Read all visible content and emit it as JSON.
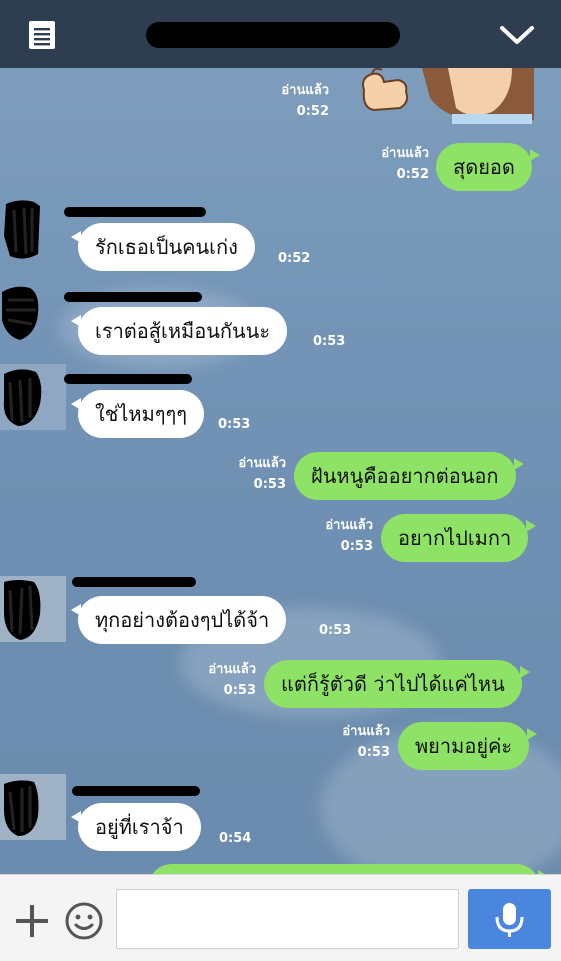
{
  "header": {
    "title": "",
    "menu_icon": "list-icon",
    "collapse_icon": "chevron-down-icon"
  },
  "messages": [
    {
      "side": "out",
      "kind": "sticker",
      "read": "อ่านแล้ว",
      "time": "0:52"
    },
    {
      "side": "out",
      "text": "สุดยอด",
      "read": "อ่านแล้ว",
      "time": "0:52"
    },
    {
      "side": "in",
      "text": "รักเธอเป็นคนเก่ง",
      "time": "0:52"
    },
    {
      "side": "in",
      "text": "เราต่อสู้เหมือนกันนะ",
      "time": "0:53"
    },
    {
      "side": "in",
      "text": "ใช่ไหมๆๆๆ",
      "time": "0:53"
    },
    {
      "side": "out",
      "text": "ฝันหนูคืออยากต่อนอก",
      "read": "อ่านแล้ว",
      "time": "0:53"
    },
    {
      "side": "out",
      "text": "อยากไปเมกา",
      "read": "อ่านแล้ว",
      "time": "0:53"
    },
    {
      "side": "in",
      "text": "ทุกอย่างต้องๆปได้จ้า",
      "time": "0:53"
    },
    {
      "side": "out",
      "text": "แต่ก็รู้ตัวดี ว่าไปได้แค่ไหน",
      "read": "อ่านแล้ว",
      "time": "0:53"
    },
    {
      "side": "out",
      "text": "พยามอยู่ค่ะ",
      "read": "อ่านแล้ว",
      "time": "0:53"
    },
    {
      "side": "in",
      "text": "อยู่ที่เราจ้า",
      "time": "0:54"
    }
  ],
  "footer": {
    "input_placeholder": "",
    "plus_icon": "plus-icon",
    "emoji_icon": "smiley-icon",
    "mic_icon": "microphone-icon",
    "mic_color": "#4a86dd"
  },
  "colors": {
    "header": "#2f3d50",
    "outgoing_bubble": "#8ee266",
    "incoming_bubble": "#ffffff"
  }
}
